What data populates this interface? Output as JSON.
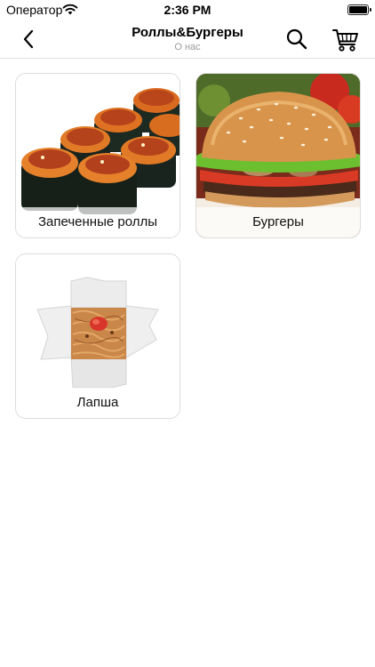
{
  "status_bar": {
    "carrier": "Оператор",
    "time": "2:36 PM"
  },
  "nav": {
    "title": "Роллы&Бургеры",
    "subtitle": "О нас",
    "back_icon": "chevron-left-icon",
    "search_icon": "search-icon",
    "cart_icon": "cart-icon"
  },
  "categories": [
    {
      "label": "Запеченные роллы",
      "image": "baked-rolls"
    },
    {
      "label": "Бургеры",
      "image": "burger"
    },
    {
      "label": "Лапша",
      "image": "noodle-box"
    }
  ],
  "colors": {
    "card_border": "#dcdcdc",
    "nav_border": "#e2e2e2",
    "subtitle": "#9a9a9a"
  }
}
